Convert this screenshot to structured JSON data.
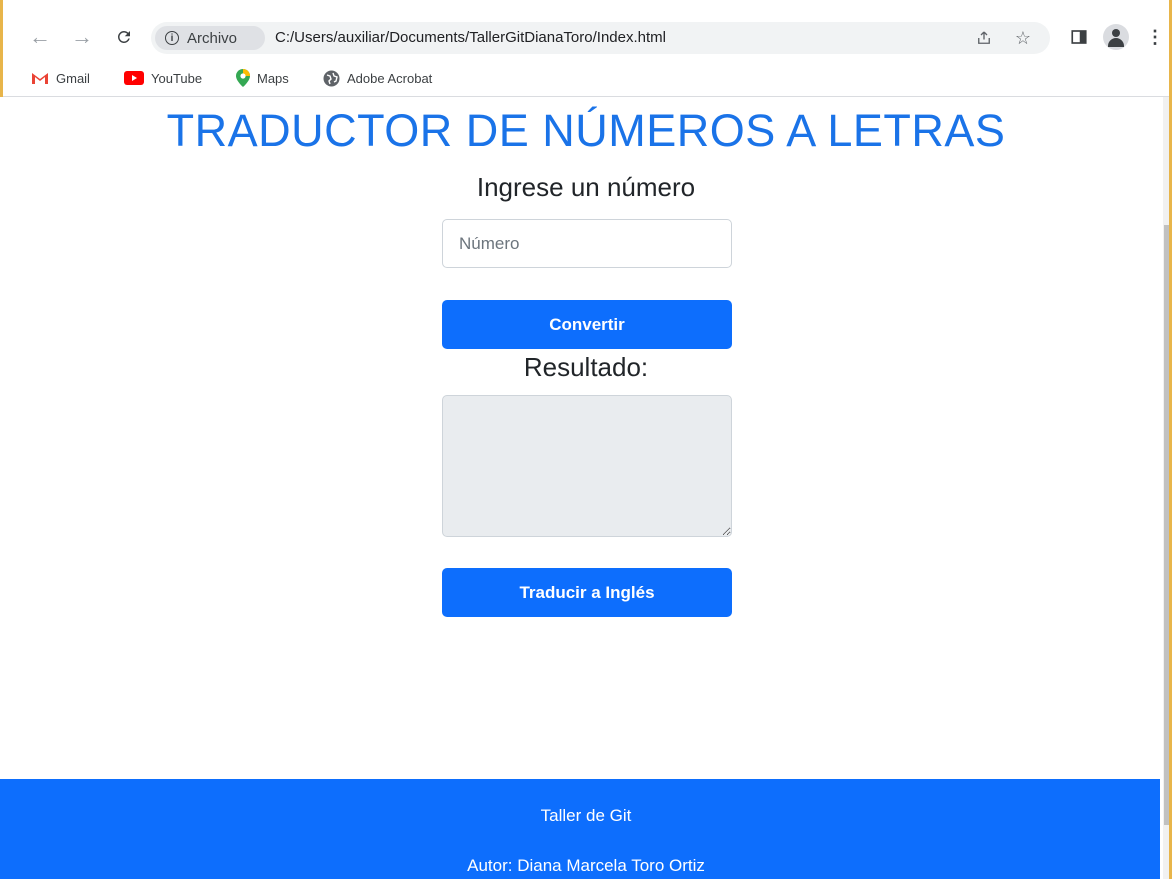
{
  "browser": {
    "site_label": "Archivo",
    "url": "C:/Users/auxiliar/Documents/TallerGitDianaToro/Index.html",
    "bookmarks": [
      {
        "label": "Gmail"
      },
      {
        "label": "YouTube"
      },
      {
        "label": "Maps"
      },
      {
        "label": "Adobe Acrobat"
      }
    ]
  },
  "page": {
    "title": "TRADUCTOR DE NÚMEROS A LETRAS",
    "prompt": "Ingrese un número",
    "number_input": {
      "placeholder": "Número",
      "value": ""
    },
    "convert_button": "Convertir",
    "result_label": "Resultado:",
    "result_value": "",
    "translate_button": "Traducir a Inglés"
  },
  "footer": {
    "line1": "Taller de Git",
    "line2": "Autor: Diana Marcela Toro Ortiz"
  },
  "colors": {
    "accent": "#0d6efd",
    "title": "#1a73e8",
    "window_border": "#e8b54a"
  }
}
